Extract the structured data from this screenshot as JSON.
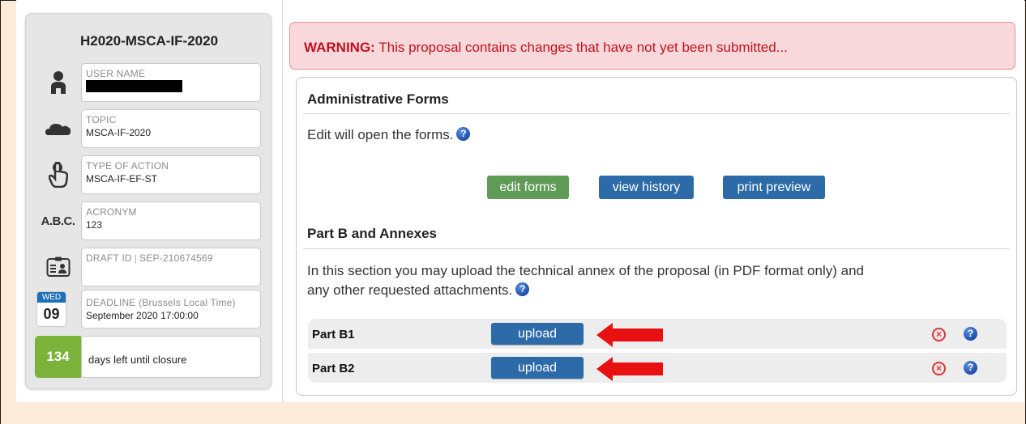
{
  "sidebar": {
    "call_id": "H2020-MSCA-IF-2020",
    "user": {
      "label": "USER NAME"
    },
    "topic": {
      "label": "TOPIC",
      "value": "MSCA-IF-2020"
    },
    "type_of_action": {
      "label": "TYPE OF ACTION",
      "value": "MSCA-IF-EF-ST"
    },
    "acronym": {
      "icon_text": "A.B.C.",
      "label": "ACRONYM",
      "value": "123"
    },
    "draft": {
      "label": "DRAFT ID",
      "value": "SEP-210674569"
    },
    "deadline": {
      "weekday": "WED",
      "day": "09",
      "label": "DEADLINE (Brussels Local Time)",
      "value": "September 2020 17:00:00"
    },
    "days_left": {
      "count": "134",
      "text": "days left until closure"
    }
  },
  "warning": {
    "strong": "WARNING:",
    "text": " This proposal contains changes that have not yet been submitted..."
  },
  "admin": {
    "heading": "Administrative Forms",
    "text": "Edit will open the forms.",
    "buttons": {
      "edit": "edit forms",
      "history": "view history",
      "print": "print preview"
    }
  },
  "partb": {
    "heading": "Part B and Annexes",
    "text_line1": "In this section you may upload the technical annex of the proposal (in PDF format only) and",
    "text_line2": "any other requested attachments.",
    "rows": [
      {
        "label": "Part B1",
        "button": "upload"
      },
      {
        "label": "Part B2",
        "button": "upload"
      }
    ]
  },
  "help_glyph": "?",
  "delete_glyph": "×",
  "colors": {
    "warning_text": "#c0111f",
    "green_button": "#5f9a57",
    "blue_button": "#2d6ba8",
    "days_badge": "#7bb33a",
    "arrow": "#e81010"
  }
}
